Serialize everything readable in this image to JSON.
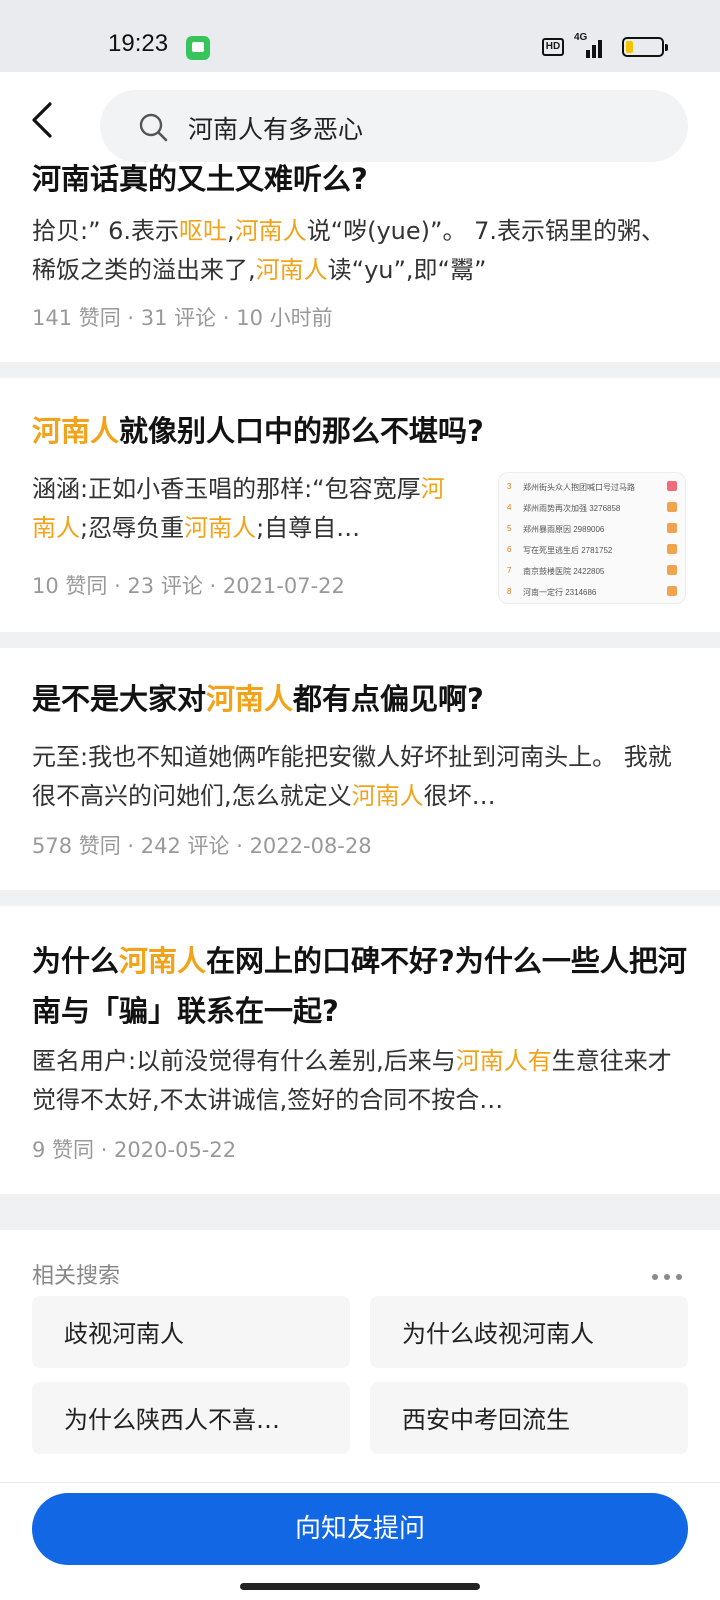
{
  "status": {
    "time": "19:23",
    "hd": "HD",
    "network": "4G",
    "battery_level": 0.2
  },
  "search": {
    "query": "河南人有多恶心"
  },
  "results": [
    {
      "title_segments": [
        {
          "t": "河南话真的又土又难听么?",
          "hl": false
        }
      ],
      "excerpt_segments": [
        {
          "t": "拾贝:” 6.表示",
          "hl": false
        },
        {
          "t": "呕吐",
          "hl": true
        },
        {
          "t": ",",
          "hl": false
        },
        {
          "t": "河南人",
          "hl": true
        },
        {
          "t": "说“哕(yue)”。 7.表示锅里的粥、稀饭之类的溢出来了,",
          "hl": false
        },
        {
          "t": "河南人",
          "hl": true
        },
        {
          "t": "读“yu”,即“鬻”",
          "hl": false
        }
      ],
      "meta": "141 赞同 · 31 评论 · 10 小时前"
    },
    {
      "title_segments": [
        {
          "t": "河南人",
          "hl": true
        },
        {
          "t": "就像别人口中的那么不堪吗?",
          "hl": false
        }
      ],
      "excerpt_segments": [
        {
          "t": "涵涵:正如小香玉唱的那样:“包容宽厚",
          "hl": false
        },
        {
          "t": "河南人",
          "hl": true
        },
        {
          "t": ";忍辱负重",
          "hl": false
        },
        {
          "t": "河南人",
          "hl": true
        },
        {
          "t": ";自尊自…",
          "hl": false
        }
      ],
      "meta": "10 赞同 · 23 评论 · 2021-07-22",
      "thumbnail_rows": [
        {
          "rank": "3",
          "text": "郑州街头众人抱团喊口号过马路"
        },
        {
          "rank": "4",
          "text": "郑州雨势再次加强 3276858"
        },
        {
          "rank": "5",
          "text": "郑州暴雨原因 2989006"
        },
        {
          "rank": "6",
          "text": "写在死里逃生后 2781752"
        },
        {
          "rank": "7",
          "text": "南京鼓楼医院 2422805"
        },
        {
          "rank": "8",
          "text": "河南一定行 2314686"
        }
      ]
    },
    {
      "title_segments": [
        {
          "t": "是不是大家对",
          "hl": false
        },
        {
          "t": "河南人",
          "hl": true
        },
        {
          "t": "都有点偏见啊?",
          "hl": false
        }
      ],
      "excerpt_segments": [
        {
          "t": "元至:我也不知道她俩咋能把安徽人好坏扯到河南头上。 我就很不高兴的问她们,怎么就定义",
          "hl": false
        },
        {
          "t": "河南人",
          "hl": true
        },
        {
          "t": "很坏…",
          "hl": false
        }
      ],
      "meta": "578 赞同 · 242 评论 · 2022-08-28"
    },
    {
      "title_segments": [
        {
          "t": "为什么",
          "hl": false
        },
        {
          "t": "河南人",
          "hl": true
        },
        {
          "t": "在网上的口碑不好?为什么一些人把河南与「骗」联系在一起?",
          "hl": false
        }
      ],
      "excerpt_segments": [
        {
          "t": "匿名用户:以前没觉得有什么差别,后来与",
          "hl": false
        },
        {
          "t": "河南人有",
          "hl": true
        },
        {
          "t": "生意往来才觉得不太好,不太讲诚信,签好的合同不按合…",
          "hl": false
        }
      ],
      "meta": "9 赞同 · 2020-05-22"
    }
  ],
  "related": {
    "title": "相关搜索",
    "items": [
      "歧视河南人",
      "为什么歧视河南人",
      "为什么陕西人不喜…",
      "西安中考回流生"
    ]
  },
  "ask_button": "向知友提问"
}
